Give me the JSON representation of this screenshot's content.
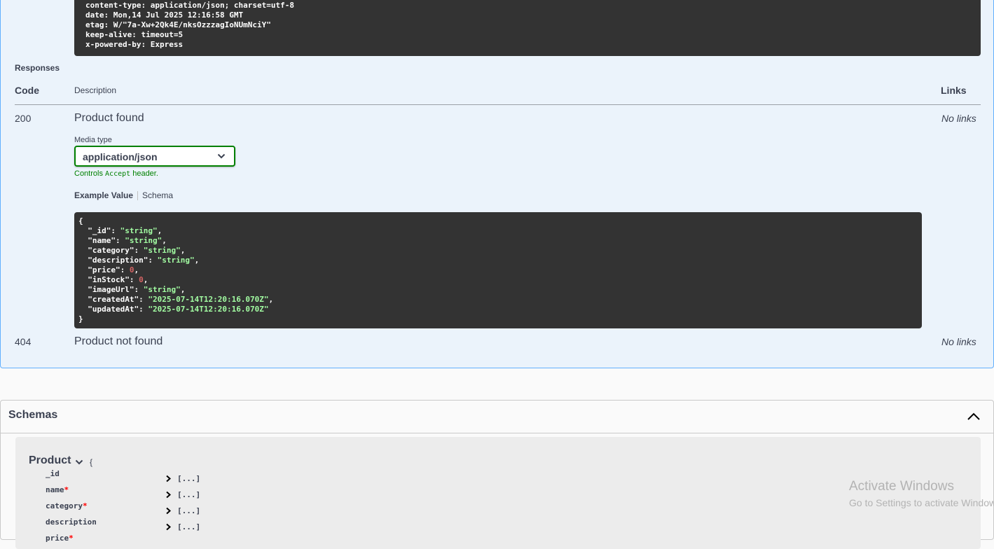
{
  "response_headers": [
    "content-type: application/json; charset=utf-8",
    "date: Mon,14 Jul 2025 12:16:58 GMT",
    "etag: W/\"7a-Xw+2Qk4E/nksOzzzagIoNUmNciY\"",
    "keep-alive: timeout=5",
    "x-powered-by: Express"
  ],
  "responses": {
    "title": "Responses",
    "columns": {
      "code": "Code",
      "description": "Description",
      "links": "Links"
    },
    "rows": [
      {
        "code": "200",
        "description": "Product found",
        "links": "No links"
      },
      {
        "code": "404",
        "description": "Product not found",
        "links": "No links"
      }
    ],
    "media_type_label": "Media type",
    "media_type_value": "application/json",
    "controls_prefix": "Controls ",
    "controls_code": "Accept",
    "controls_suffix": " header.",
    "tabs": {
      "example": "Example Value",
      "schema": "Schema"
    },
    "example_json": {
      "open": "{",
      "fields": [
        {
          "key": "\"_id\"",
          "value": "\"string\"",
          "kind": "string",
          "trail": ","
        },
        {
          "key": "\"name\"",
          "value": "\"string\"",
          "kind": "string",
          "trail": ","
        },
        {
          "key": "\"category\"",
          "value": "\"string\"",
          "kind": "string",
          "trail": ","
        },
        {
          "key": "\"description\"",
          "value": "\"string\"",
          "kind": "string",
          "trail": ","
        },
        {
          "key": "\"price\"",
          "value": "0",
          "kind": "number",
          "trail": ","
        },
        {
          "key": "\"inStock\"",
          "value": "0",
          "kind": "number",
          "trail": ","
        },
        {
          "key": "\"imageUrl\"",
          "value": "\"string\"",
          "kind": "string",
          "trail": ","
        },
        {
          "key": "\"createdAt\"",
          "value": "\"2025-07-14T12:20:16.070Z\"",
          "kind": "string",
          "trail": ","
        },
        {
          "key": "\"updatedAt\"",
          "value": "\"2025-07-14T12:20:16.070Z\"",
          "kind": "string",
          "trail": ""
        }
      ],
      "close": "}"
    }
  },
  "schemas": {
    "title": "Schemas",
    "toggle_icon": "chevron-up-icon",
    "model": {
      "name": "Product",
      "brace": "{",
      "properties": [
        {
          "name": "_id",
          "required": false,
          "type": "[...]"
        },
        {
          "name": "name",
          "required": true,
          "type": "[...]"
        },
        {
          "name": "category",
          "required": true,
          "type": "[...]"
        },
        {
          "name": "description",
          "required": false,
          "type": "[...]"
        },
        {
          "name": "price",
          "required": true,
          "type": ""
        }
      ]
    }
  },
  "watermark": {
    "line1": "Activate Windows",
    "line2": "Go to Settings to activate Windows."
  },
  "colors": {
    "op_bg": "#ebf3fb",
    "op_border": "#61affe",
    "code_bg": "#333333",
    "string": "#a2fca2",
    "number": "#d36363",
    "select_border": "#008000"
  }
}
